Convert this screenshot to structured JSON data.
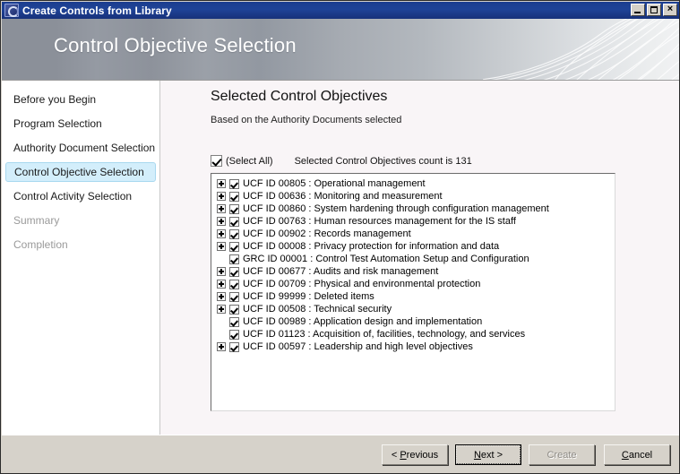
{
  "window": {
    "title": "Create Controls from Library",
    "icon": "app-icon",
    "buttons": {
      "minimize": "minimize-icon",
      "maximize": "maximize-icon",
      "close": "×"
    }
  },
  "banner": {
    "title": "Control Objective Selection"
  },
  "sidebar": {
    "items": [
      {
        "label": "Before you Begin",
        "state": "normal"
      },
      {
        "label": "Program Selection",
        "state": "normal"
      },
      {
        "label": "Authority Document Selection",
        "state": "normal"
      },
      {
        "label": "Control Objective Selection",
        "state": "active"
      },
      {
        "label": "Control Activity Selection",
        "state": "normal"
      },
      {
        "label": "Summary",
        "state": "disabled"
      },
      {
        "label": "Completion",
        "state": "disabled"
      }
    ]
  },
  "content": {
    "heading": "Selected Control Objectives",
    "subheading": "Based on the Authority Documents selected",
    "select_all_label": "(Select All)",
    "select_all_checked": true,
    "count_label": "Selected Control Objectives count is 131",
    "count_value": 131,
    "rows": [
      {
        "label": "UCF ID 00805 : Operational management",
        "checked": true,
        "expandable": true
      },
      {
        "label": "UCF ID 00636 : Monitoring and measurement",
        "checked": true,
        "expandable": true
      },
      {
        "label": "UCF ID 00860 : System hardening through configuration management",
        "checked": true,
        "expandable": true
      },
      {
        "label": "UCF ID 00763 : Human resources management for the IS staff",
        "checked": true,
        "expandable": true
      },
      {
        "label": "UCF ID 00902 : Records management",
        "checked": true,
        "expandable": true
      },
      {
        "label": "UCF ID 00008 : Privacy protection for information and data",
        "checked": true,
        "expandable": true
      },
      {
        "label": "GRC ID 00001 : Control Test Automation Setup and Configuration",
        "checked": true,
        "expandable": false
      },
      {
        "label": "UCF ID 00677 : Audits and risk management",
        "checked": true,
        "expandable": true
      },
      {
        "label": "UCF ID 00709 : Physical and environmental protection",
        "checked": true,
        "expandable": true
      },
      {
        "label": "UCF ID 99999 : Deleted items",
        "checked": true,
        "expandable": true
      },
      {
        "label": "UCF ID 00508 : Technical security",
        "checked": true,
        "expandable": true
      },
      {
        "label": "UCF ID 00989 : Application design and implementation",
        "checked": true,
        "expandable": false
      },
      {
        "label": "UCF ID 01123 : Acquisition of, facilities, technology, and services",
        "checked": true,
        "expandable": false
      },
      {
        "label": "UCF ID 00597 : Leadership and high level objectives",
        "checked": true,
        "expandable": true
      }
    ]
  },
  "footer": {
    "previous": "< Previous",
    "previous_pre": "< ",
    "previous_accel": "P",
    "previous_post": "revious",
    "next_pre": "",
    "next_accel": "N",
    "next_post": "ext >",
    "create": "Create",
    "cancel_pre": "",
    "cancel_accel": "C",
    "cancel_post": "ancel",
    "create_disabled": true,
    "next_focused": true
  },
  "colors": {
    "titlebar": "#1f4397",
    "active_sidebar": "#d3eefb",
    "footer_bg": "#d6d2ca",
    "content_bg": "#f9f5f7"
  }
}
